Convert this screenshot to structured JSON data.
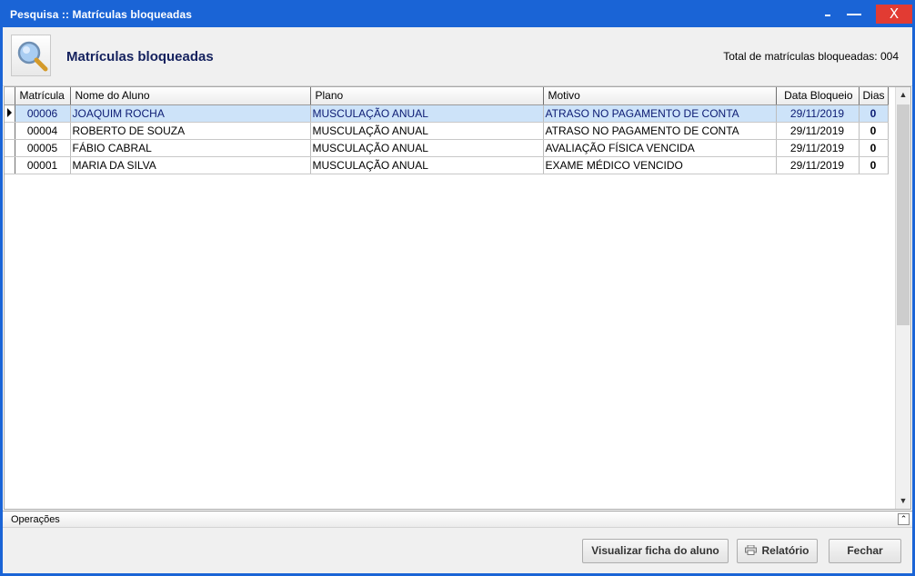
{
  "window": {
    "title": "Pesquisa :: Matrículas bloqueadas",
    "close_label": "X"
  },
  "header": {
    "title": "Matrículas bloqueadas",
    "total_text": "Total de matrículas bloqueadas: 004",
    "logo_icon": "magnifier-icon"
  },
  "grid": {
    "columns": [
      "Matrícula",
      "Nome do Aluno",
      "Plano",
      "Motivo",
      "Data Bloqueio",
      "Dias"
    ],
    "rows": [
      {
        "matricula": "00006",
        "nome": "JOAQUIM ROCHA",
        "plano": "MUSCULAÇÃO ANUAL",
        "motivo": "ATRASO NO PAGAMENTO DE CONTA",
        "data": "29/11/2019",
        "dias": "0"
      },
      {
        "matricula": "00004",
        "nome": "ROBERTO DE SOUZA",
        "plano": "MUSCULAÇÃO ANUAL",
        "motivo": "ATRASO NO PAGAMENTO DE CONTA",
        "data": "29/11/2019",
        "dias": "0"
      },
      {
        "matricula": "00005",
        "nome": "FÁBIO CABRAL",
        "plano": "MUSCULAÇÃO ANUAL",
        "motivo": "AVALIAÇÃO FÍSICA VENCIDA",
        "data": "29/11/2019",
        "dias": "0"
      },
      {
        "matricula": "00001",
        "nome": "MARIA DA SILVA",
        "plano": "MUSCULAÇÃO ANUAL",
        "motivo": "EXAME MÉDICO VENCIDO",
        "data": "29/11/2019",
        "dias": "0"
      }
    ],
    "selected_row": 0
  },
  "operations": {
    "label": "Operações"
  },
  "buttons": {
    "ficha": "Visualizar ficha do aluno",
    "relatorio": "Relatório",
    "fechar": "Fechar"
  },
  "colors": {
    "titlebar": "#1a64d6",
    "close": "#e23b33",
    "selection": "#cde3f9",
    "title_text": "#14215e"
  }
}
